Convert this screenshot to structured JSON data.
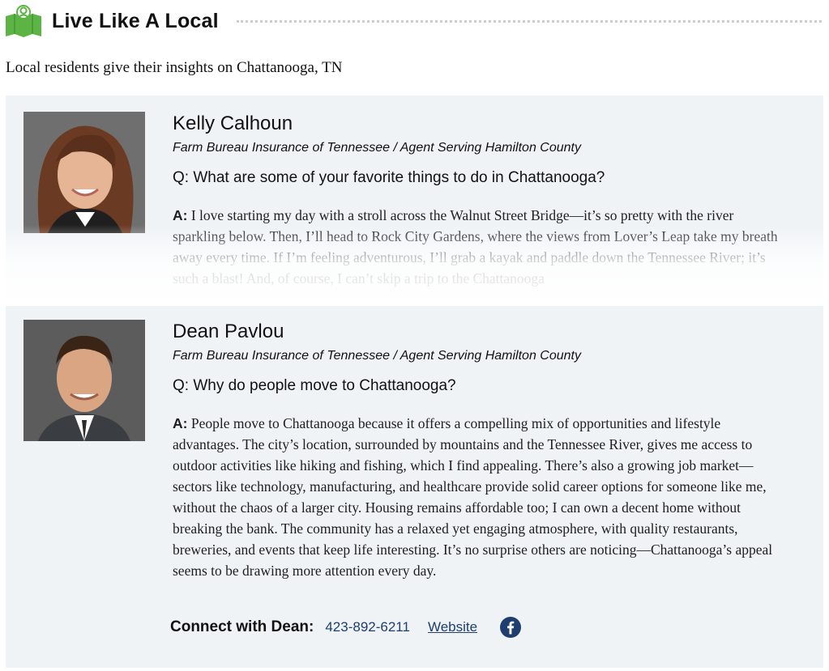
{
  "header": {
    "title": "Live Like A Local",
    "logo_icon": "local-people-map-icon"
  },
  "subtitle": "Local residents give their insights on Chattanooga, TN",
  "colors": {
    "brand_green": "#5bb443",
    "link_blue": "#1f3e6f",
    "card_bg": "#eff3f6"
  },
  "residents": [
    {
      "name": "Kelly Calhoun",
      "role": "Farm Bureau Insurance of Tennessee / Agent Serving Hamilton County",
      "question": "Q: What are some of your favorite things to do in Chattanooga?",
      "answer_label": "A:",
      "answer": "I love starting my day with a stroll across the Walnut Street Bridge—it’s so pretty with the river sparkling below. Then, I’ll head to Rock City Gardens, where the views from Lover’s Leap take my breath away every time. If I’m feeling adventurous, I’ll grab a kayak and paddle down the Tennessee River; it’s such a blast! And, of course, I can’t skip a trip to the Chattanooga"
    },
    {
      "name": "Dean Pavlou",
      "role": "Farm Bureau Insurance of Tennessee / Agent Serving Hamilton County",
      "question": "Q: Why do people move to Chattanooga?",
      "answer_label": "A:",
      "answer": "People move to Chattanooga because it offers a compelling mix of opportunities and life­style advantages. The city’s location, surrounded by mountains and the Tennessee River, gives me access to outdoor activities like hiking and fishing, which I find appealing. There’s also a growing job market—sectors like technology, manufacturing, and healthcare provide solid career options for someone like me, without the chaos of a larger city. Housing remains afford­able too; I can own a decent home without breaking the bank. The community has a relaxed yet engaging atmosphere, with quality restaurants, breweries, and events that keep life interesting. It’s no surprise others are noticing—Chattanooga’s appeal seems to be drawing more attention every day.",
      "connect_label": "Connect with Dean:",
      "phone": "423-892-6211",
      "website_label": "Website",
      "social_icon": "facebook-icon"
    }
  ]
}
